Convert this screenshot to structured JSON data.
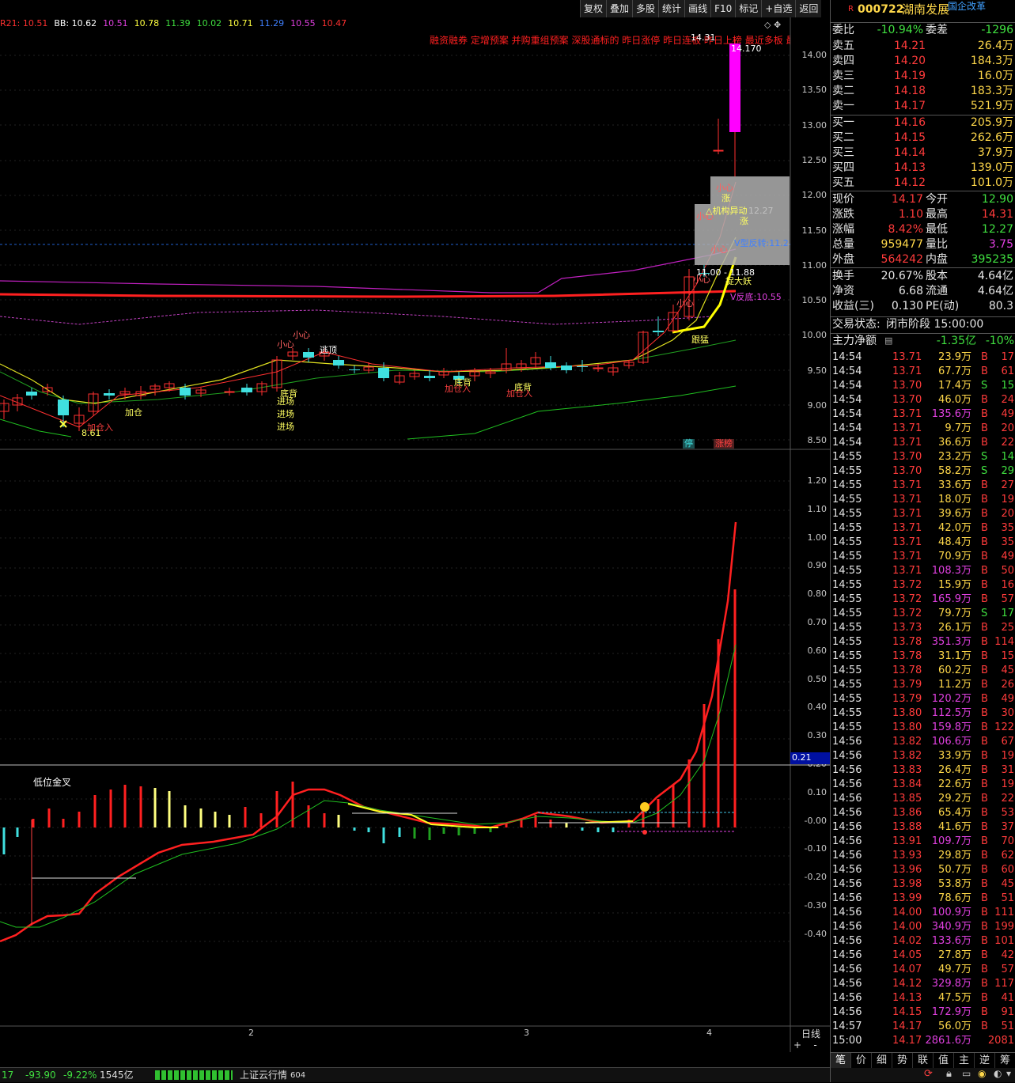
{
  "toolbar": [
    "复权",
    "叠加",
    "多股",
    "统计",
    "画线",
    "F10",
    "标记",
    "+自选",
    "返回"
  ],
  "ma_line": [
    {
      "t": "R21: 10.51",
      "c": "#ff3030"
    },
    {
      "t": "BB: 10.62",
      "c": "#ffffff"
    },
    {
      "t": "10.51",
      "c": "#e040e0"
    },
    {
      "t": "10.78",
      "c": "#ffff40"
    },
    {
      "t": "11.39",
      "c": "#40e040"
    },
    {
      "t": "10.02",
      "c": "#40e040"
    },
    {
      "t": "10.71",
      "c": "#ffff40"
    },
    {
      "t": "11.29",
      "c": "#4080ff"
    },
    {
      "t": "10.55",
      "c": "#e040e0"
    },
    {
      "t": "10.47",
      "c": "#ff3030"
    }
  ],
  "tags_text": "融资融券 定增预案 并购重组预案 深股通标的 昨日涨停 昨日连板 昨日上榜 最近多板 最",
  "price_axis": [
    "14.00",
    "13.50",
    "13.00",
    "12.50",
    "12.00",
    "11.50",
    "11.00",
    "10.50",
    "10.00",
    "9.50",
    "9.00",
    "8.50"
  ],
  "ind_axis": [
    "1.20",
    "1.10",
    "1.00",
    "0.90",
    "0.80",
    "0.70",
    "0.60",
    "0.50",
    "0.40",
    "0.30",
    "0.20",
    "0.10",
    "-0.00",
    "-0.10",
    "-0.20",
    "-0.30",
    "-0.40"
  ],
  "ind_current": "0.21",
  "ind_label": "低位金叉",
  "time_axis": [
    "2",
    "3",
    "4"
  ],
  "period": "日线",
  "high_label": "14.31",
  "high_label2": "14.170",
  "annotations": [
    {
      "t": "小心",
      "c": "#ff6060"
    },
    {
      "t": "小心",
      "c": "#ff6060"
    },
    {
      "t": "逃顶",
      "c": "#ffffff"
    },
    {
      "t": "底背",
      "c": "#ffff60"
    },
    {
      "t": "进场",
      "c": "#ffff60"
    },
    {
      "t": "进场",
      "c": "#ffff60"
    },
    {
      "t": "进场",
      "c": "#ffff60"
    },
    {
      "t": "加仓",
      "c": "#ffff60"
    },
    {
      "t": "加仓入",
      "c": "#ff4040"
    },
    {
      "t": "8.61",
      "c": "#ffff60"
    },
    {
      "t": "底背",
      "c": "#ffff60"
    },
    {
      "t": "加仓入",
      "c": "#ff4040"
    },
    {
      "t": "底背",
      "c": "#ffff60"
    },
    {
      "t": "加仓入",
      "c": "#ff4040"
    },
    {
      "t": "小心",
      "c": "#ff6060"
    },
    {
      "t": "小心",
      "c": "#ff6060"
    },
    {
      "t": "涨",
      "c": "#ffff60"
    },
    {
      "t": "△机构异动",
      "c": "#ffff60"
    },
    {
      "t": "12.27",
      "c": "#c0c0c0"
    },
    {
      "t": "涨",
      "c": "#ffff60"
    },
    {
      "t": "V型反转:11.2",
      "c": "#4080ff"
    },
    {
      "t": "小心",
      "c": "#ff6060"
    },
    {
      "t": "11.00 - 11.88",
      "c": "#ffffff"
    },
    {
      "t": "捉大妖",
      "c": "#ffff60"
    },
    {
      "t": "V反底:10.55",
      "c": "#e040e0"
    },
    {
      "t": "小心",
      "c": "#ff6060"
    },
    {
      "t": "小心",
      "c": "#ff6060"
    },
    {
      "t": "跟猛",
      "c": "#ffff60"
    },
    {
      "t": "停",
      "c": "#40e0e0"
    },
    {
      "t": "涨榜",
      "c": "#ff4040"
    }
  ],
  "stock": {
    "code": "000722",
    "name": "湖南发展",
    "tag": "国企改革",
    "flag": "R"
  },
  "webi": {
    "label": "委比",
    "value": "-10.94%",
    "label2": "委差",
    "value2": "-1296"
  },
  "sell": [
    {
      "l": "卖五",
      "p": "14.21",
      "v": "26.4万"
    },
    {
      "l": "卖四",
      "p": "14.20",
      "v": "184.3万"
    },
    {
      "l": "卖三",
      "p": "14.19",
      "v": "16.0万"
    },
    {
      "l": "卖二",
      "p": "14.18",
      "v": "183.3万"
    },
    {
      "l": "卖一",
      "p": "14.17",
      "v": "521.9万"
    }
  ],
  "buy": [
    {
      "l": "买一",
      "p": "14.16",
      "v": "205.9万"
    },
    {
      "l": "买二",
      "p": "14.15",
      "v": "262.6万"
    },
    {
      "l": "买三",
      "p": "14.14",
      "v": "37.9万"
    },
    {
      "l": "买四",
      "p": "14.13",
      "v": "139.0万"
    },
    {
      "l": "买五",
      "p": "14.12",
      "v": "101.0万"
    }
  ],
  "quote": [
    {
      "a": "现价",
      "b": "14.17",
      "bc": "#ff3b3b",
      "c": "今开",
      "d": "12.90",
      "dc": "#40e040"
    },
    {
      "a": "涨跌",
      "b": "1.10",
      "bc": "#ff3b3b",
      "c": "最高",
      "d": "14.31",
      "dc": "#ff3b3b"
    },
    {
      "a": "涨幅",
      "b": "8.42%",
      "bc": "#ff3b3b",
      "c": "最低",
      "d": "12.27",
      "dc": "#40e040"
    },
    {
      "a": "总量",
      "b": "959477",
      "bc": "#ffd84a",
      "c": "量比",
      "d": "3.75",
      "dc": "#e040e0"
    },
    {
      "a": "外盘",
      "b": "564242",
      "bc": "#ff3b3b",
      "c": "内盘",
      "d": "395235",
      "dc": "#40e040"
    }
  ],
  "quote2": [
    {
      "a": "换手",
      "b": "20.67%",
      "bc": "#e6e6e6",
      "c": "股本",
      "d": "4.64亿",
      "dc": "#e6e6e6"
    },
    {
      "a": "净资",
      "b": "6.68",
      "bc": "#e6e6e6",
      "c": "流通",
      "d": "4.64亿",
      "dc": "#e6e6e6"
    },
    {
      "a": "收益(三)",
      "b": "0.130",
      "bc": "#e6e6e6",
      "c": "PE(动)",
      "d": "80.3",
      "dc": "#e6e6e6"
    }
  ],
  "trade_status": {
    "label": "交易状态:",
    "value": "闭市阶段 15:00:00"
  },
  "mainflow": {
    "label": "主力净额",
    "value": "-1.35亿",
    "pct": "-10%"
  },
  "ticks": [
    [
      "14:54",
      "13.71",
      "23.9万",
      "B",
      "17"
    ],
    [
      "14:54",
      "13.71",
      "67.7万",
      "B",
      "61"
    ],
    [
      "14:54",
      "13.70",
      "17.4万",
      "S",
      "15"
    ],
    [
      "14:54",
      "13.70",
      "46.0万",
      "B",
      "24"
    ],
    [
      "14:54",
      "13.71",
      "135.6万",
      "B",
      "49"
    ],
    [
      "14:54",
      "13.71",
      "9.7万",
      "B",
      "20"
    ],
    [
      "14:54",
      "13.71",
      "36.6万",
      "B",
      "22"
    ],
    [
      "14:55",
      "13.70",
      "23.2万",
      "S",
      "14"
    ],
    [
      "14:55",
      "13.70",
      "58.2万",
      "S",
      "29"
    ],
    [
      "14:55",
      "13.71",
      "33.6万",
      "B",
      "27"
    ],
    [
      "14:55",
      "13.71",
      "18.0万",
      "B",
      "19"
    ],
    [
      "14:55",
      "13.71",
      "39.6万",
      "B",
      "20"
    ],
    [
      "14:55",
      "13.71",
      "42.0万",
      "B",
      "35"
    ],
    [
      "14:55",
      "13.71",
      "48.4万",
      "B",
      "35"
    ],
    [
      "14:55",
      "13.71",
      "70.9万",
      "B",
      "49"
    ],
    [
      "14:55",
      "13.71",
      "108.3万",
      "B",
      "50"
    ],
    [
      "14:55",
      "13.72",
      "15.9万",
      "B",
      "16"
    ],
    [
      "14:55",
      "13.72",
      "165.9万",
      "B",
      "57"
    ],
    [
      "14:55",
      "13.72",
      "79.7万",
      "S",
      "17"
    ],
    [
      "14:55",
      "13.73",
      "26.1万",
      "B",
      "25"
    ],
    [
      "14:55",
      "13.78",
      "351.3万",
      "B",
      "114"
    ],
    [
      "14:55",
      "13.78",
      "31.1万",
      "B",
      "15"
    ],
    [
      "14:55",
      "13.78",
      "60.2万",
      "B",
      "45"
    ],
    [
      "14:55",
      "13.79",
      "11.2万",
      "B",
      "26"
    ],
    [
      "14:55",
      "13.79",
      "120.2万",
      "B",
      "49"
    ],
    [
      "14:55",
      "13.80",
      "112.5万",
      "B",
      "30"
    ],
    [
      "14:55",
      "13.80",
      "159.8万",
      "B",
      "122"
    ],
    [
      "14:56",
      "13.82",
      "106.6万",
      "B",
      "67"
    ],
    [
      "14:56",
      "13.82",
      "33.9万",
      "B",
      "19"
    ],
    [
      "14:56",
      "13.83",
      "26.4万",
      "B",
      "31"
    ],
    [
      "14:56",
      "13.84",
      "22.6万",
      "B",
      "19"
    ],
    [
      "14:56",
      "13.85",
      "29.2万",
      "B",
      "22"
    ],
    [
      "14:56",
      "13.86",
      "65.4万",
      "B",
      "53"
    ],
    [
      "14:56",
      "13.88",
      "41.6万",
      "B",
      "37"
    ],
    [
      "14:56",
      "13.91",
      "109.7万",
      "B",
      "70"
    ],
    [
      "14:56",
      "13.93",
      "29.8万",
      "B",
      "62"
    ],
    [
      "14:56",
      "13.96",
      "50.7万",
      "B",
      "60"
    ],
    [
      "14:56",
      "13.98",
      "53.8万",
      "B",
      "45"
    ],
    [
      "14:56",
      "13.99",
      "78.6万",
      "B",
      "51"
    ],
    [
      "14:56",
      "14.00",
      "100.9万",
      "B",
      "111"
    ],
    [
      "14:56",
      "14.00",
      "340.9万",
      "B",
      "199"
    ],
    [
      "14:56",
      "14.02",
      "133.6万",
      "B",
      "101"
    ],
    [
      "14:56",
      "14.05",
      "27.8万",
      "B",
      "42"
    ],
    [
      "14:56",
      "14.07",
      "49.7万",
      "B",
      "57"
    ],
    [
      "14:56",
      "14.12",
      "329.8万",
      "B",
      "117"
    ],
    [
      "14:56",
      "14.13",
      "47.5万",
      "B",
      "41"
    ],
    [
      "14:56",
      "14.15",
      "172.9万",
      "B",
      "91"
    ],
    [
      "14:57",
      "14.17",
      "56.0万",
      "B",
      "51"
    ],
    [
      "15:00",
      "14.17",
      "2861.6万",
      "",
      "2081"
    ]
  ],
  "tabs": [
    "笔",
    "价",
    "细",
    "势",
    "联",
    "值",
    "主",
    "逆",
    "筹"
  ],
  "bottom": {
    "a": "17",
    "b": "-93.90",
    "c": "-9.22%",
    "d": "1545亿",
    "e": "上证云行情",
    "f": "604"
  }
}
